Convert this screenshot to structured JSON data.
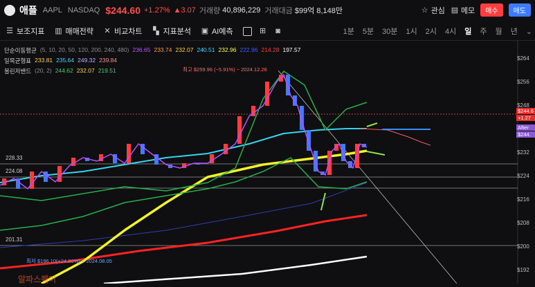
{
  "header": {
    "logo_glyph": "",
    "name": "애플",
    "ticker": "AAPL",
    "exchange": "NASDAQ",
    "price": "$244.60",
    "change_pct": "+1.27%",
    "change_abs": "▲3.07",
    "volume_label": "거래량",
    "volume": "40,896,229",
    "amount_label": "거래대금",
    "amount": "$99억 8,148만",
    "watch_label": "관심",
    "memo_label": "메모",
    "buy_label": "매수",
    "sell_label": "매도"
  },
  "toolbar": {
    "indicators": "보조지표",
    "strategy": "매매전략",
    "compare": "비교차트",
    "analysis": "지표분석",
    "ai": "AI예측",
    "timeframes": [
      "1분",
      "5분",
      "30분",
      "1시",
      "2시",
      "4시",
      "일",
      "주",
      "월",
      "년"
    ],
    "active_timeframe": "일"
  },
  "legends": {
    "sma": {
      "label": "단순이동평균",
      "params": "(5, 10, 20, 50, 120, 200, 240, 480)",
      "values": [
        "236.65",
        "233.74",
        "232.07",
        "240.51",
        "232.96",
        "222.96",
        "214.28",
        "197.57"
      ],
      "colors": [
        "#c050ff",
        "#ff9b3d",
        "#ffd23d",
        "#3dd6ff",
        "#ffff3d",
        "#3f5bff",
        "#ff3a3a",
        "#ffffff"
      ]
    },
    "ichimoku": {
      "label": "일목균형표",
      "values": [
        "233.81",
        "235.64",
        "249.32",
        "239.84"
      ],
      "colors": [
        "#ffd23d",
        "#3dd6ff",
        "#bdb0ff",
        "#ff8a8a"
      ]
    },
    "bollinger": {
      "label": "볼린저밴드",
      "params": "(20, 2)",
      "values": [
        "244.62",
        "232.07",
        "219.51"
      ],
      "colors": [
        "#3fd06b",
        "#ffd23d",
        "#3fd06b"
      ]
    }
  },
  "axis": {
    "price_ticks": [
      "$264",
      "$256",
      "$248",
      "$240",
      "$232",
      "$224",
      "$216",
      "$208",
      "$200",
      "$192"
    ],
    "last_price_tag": "$244.6",
    "last_pct_tag": "+1.27",
    "after_label": "After",
    "after_price": "$244."
  },
  "annotations": {
    "high": "최고 $259.96 (−5.91%) − 2024.12.26",
    "low": "최저 $196.10(+24.80%) − 2024.08.05",
    "level_1": "228.33",
    "level_2": "224.08",
    "level_3": "201.31",
    "watermark": "알파스퀘어"
  }
}
